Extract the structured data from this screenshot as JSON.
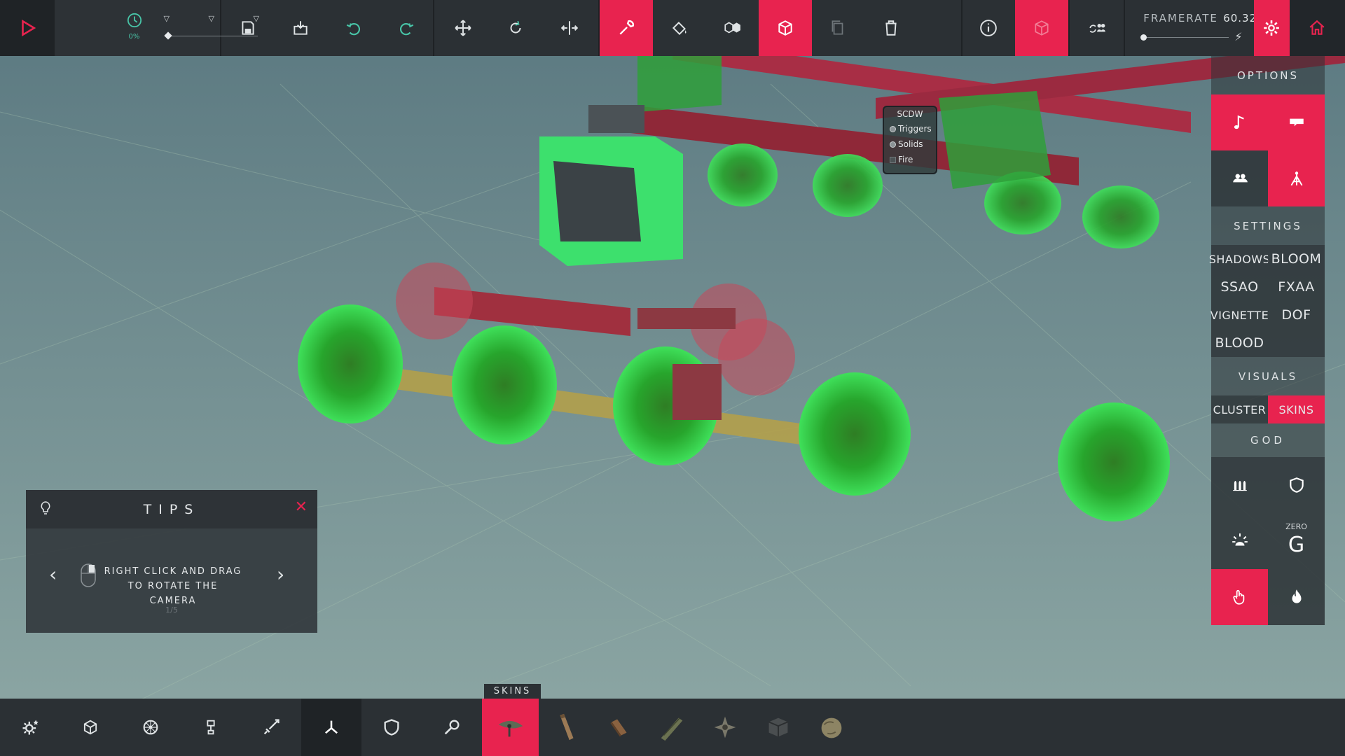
{
  "colors": {
    "accent": "#e8234f",
    "bar_bg": "#2b3034",
    "time_green": "#48c4a7",
    "block_green": "#3ddc5a"
  },
  "topbar": {
    "play_icon": "play-icon",
    "time_scale_icon": "clock-icon",
    "time_scale_value": "0%",
    "time_scale_level": 0,
    "save_icon": "save-icon",
    "load_icon": "load-icon",
    "undo_icon": "undo-icon",
    "redo_icon": "redo-icon",
    "move_icon": "move-icon",
    "rotate_icon": "rotate-icon",
    "mirror_icon": "mirror-icon",
    "wrench_icon": "wrench-icon",
    "paint_icon": "paint-bucket-icon",
    "boundaries_icon": "boundaries-icon",
    "box_icon": "box-icon",
    "copy_icon": "copy-icon",
    "trash_icon": "trash-icon",
    "info_icon": "info-icon",
    "cube_icon": "cube-icon",
    "multiplayer_icon": "multiplayer-icon",
    "framerate_label": "FRAMERATE",
    "framerate_value": "60.32",
    "settings_icon": "gear-icon",
    "home_icon": "home-icon"
  },
  "debug": {
    "title": "SCDW",
    "items": [
      "Triggers",
      "Solids",
      "Fire"
    ]
  },
  "right_panel": {
    "options_title": "OPTIONS",
    "settings_title": "SETTINGS",
    "settings": {
      "shadows": "SHADOWS",
      "bloom": "BLOOM",
      "ssao": "SSAO",
      "fxaa": "FXAA",
      "vignette": "VIGNETTE",
      "dof": "DOF",
      "blood": "BLOOD"
    },
    "visuals_title": "VISUALS",
    "visuals": {
      "cluster": "CLUSTER",
      "skins": "SKINS"
    },
    "god_title": "GOD",
    "zero_g_small": "ZERO",
    "zero_g_big": "G"
  },
  "tips": {
    "title": "TIPS",
    "line1": "RIGHT CLICK AND DRAG",
    "line2": "TO ROTATE THE CAMERA",
    "page": "1/5"
  },
  "bottombar": {
    "active_tab": "SKINS",
    "categories": [
      "settings",
      "blocks",
      "wheels",
      "mechanical",
      "weapons",
      "structure",
      "armour",
      "utility"
    ]
  }
}
